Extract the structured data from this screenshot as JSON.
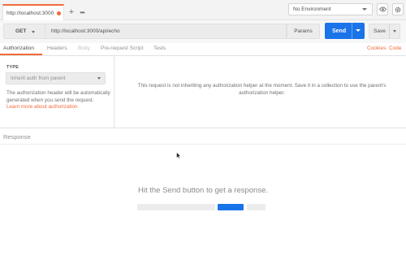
{
  "tabs": {
    "active_label": "http://localhost:3000",
    "unsaved_color": "#f26b3a",
    "add_icon": "plus-icon",
    "more_icon": "ellipsis-icon"
  },
  "environment": {
    "selected": "No Environment",
    "eye_icon": "eye-icon",
    "settings_icon": "gear-icon"
  },
  "request": {
    "method": "GET",
    "url": "http://localhost:3000/api/echo",
    "params_label": "Params",
    "send_label": "Send",
    "save_label": "Save",
    "accent": "#1a73e8"
  },
  "subtabs": {
    "items": [
      "Authorization",
      "Headers",
      "Body",
      "Pre-request Script",
      "Tests"
    ],
    "active": "Authorization",
    "right_links": [
      "Cookies",
      "Code"
    ]
  },
  "auth": {
    "type_label": "TYPE",
    "type_value": "Inherit auth from parent",
    "description": "The authorization header will be automatically generated when you send the request.",
    "learn_more": "Learn more about authorization",
    "message": "This request is not inheriting any authorization helper at the moment. Save it in a collection to use the parent's authorization helper."
  },
  "response": {
    "title": "Response",
    "hint": "Hit the Send button to get a response."
  }
}
